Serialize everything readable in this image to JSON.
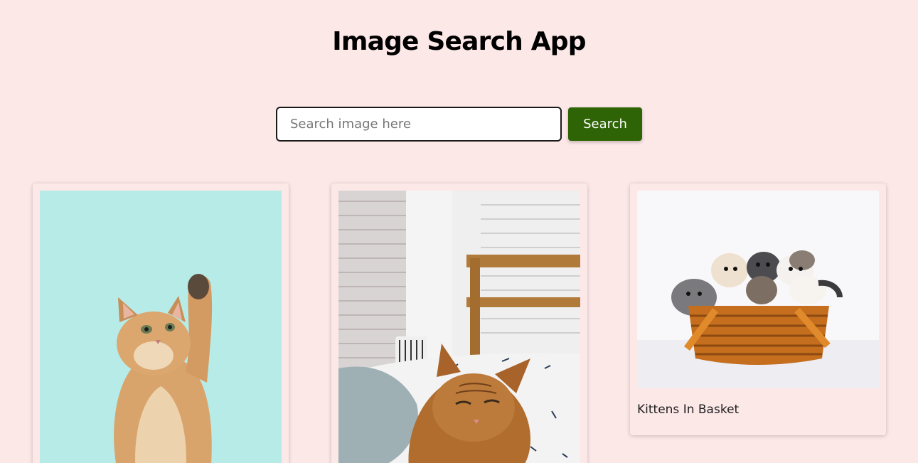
{
  "app": {
    "title": "Image Search App"
  },
  "search": {
    "placeholder": "Search image here",
    "value": "",
    "button_label": "Search"
  },
  "results": [
    {
      "image": "kitten-reaching-photo",
      "caption": ""
    },
    {
      "image": "sleeping-cat-photo",
      "caption": ""
    },
    {
      "image": "kittens-basket-photo",
      "caption": "Kittens In Basket"
    }
  ],
  "colors": {
    "background": "#fde8e8",
    "button": "#2e6405"
  }
}
